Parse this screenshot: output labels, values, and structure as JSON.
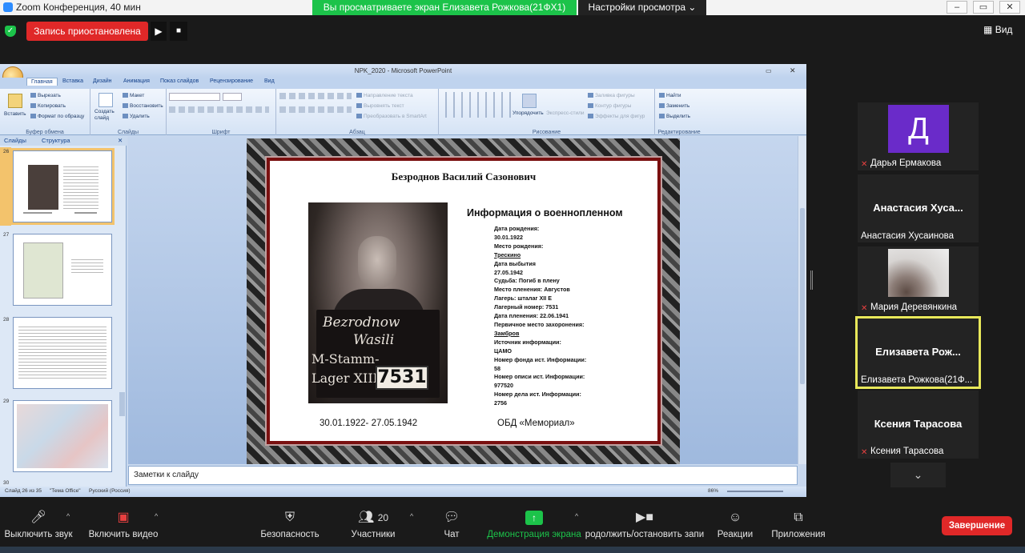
{
  "zoom": {
    "window_title": "Zoom Конференция, 40 мин",
    "share_banner": "Вы просматриваете экран Елизавета Рожкова(21ФХ1)",
    "view_settings": "Настройки просмотра",
    "recording_status": "Запись приостановлена",
    "view_label": "Вид"
  },
  "ppt": {
    "title": "NPK_2020 - Microsoft PowerPoint",
    "tabs": [
      "Главная",
      "Вставка",
      "Дизайн",
      "Анимация",
      "Показ слайдов",
      "Рецензирование",
      "Вид"
    ],
    "ribbon": {
      "paste": "Вставить",
      "cut": "Вырезать",
      "copy": "Копировать",
      "format_painter": "Формат по образцу",
      "clipboard_group": "Буфер обмена",
      "new_slide": "Создать слайд",
      "layout": "Макет",
      "reset": "Восстановить",
      "delete": "Удалить",
      "slides_group": "Слайды",
      "font_group": "Шрифт",
      "text_direction": "Направление текста",
      "align_text": "Выровнять текст",
      "smartart": "Преобразовать в SmartArt",
      "paragraph_group": "Абзац",
      "arrange": "Упорядочить",
      "quick_styles": "Экспресс-стили",
      "shape_fill": "Заливка фигуры",
      "shape_outline": "Контур фигуры",
      "shape_effects": "Эффекты для фигур",
      "drawing_group": "Рисование",
      "find": "Найти",
      "replace": "Заменить",
      "select": "Выделить",
      "editing_group": "Редактирование"
    },
    "pane_tabs": [
      "Слайды",
      "Структура"
    ],
    "thumb_numbers": [
      "26",
      "27",
      "28",
      "29",
      "30"
    ],
    "notes_placeholder": "Заметки к слайду",
    "status": {
      "slide": "Слайд 26 из 35",
      "theme": "\"Тема Office\"",
      "language": "Русский (Россия)",
      "zoom": "86%"
    }
  },
  "slide": {
    "name": "Безроднов Василий Сазонович",
    "photo_board": {
      "line1": "Bezrodnow",
      "line2": "Wasili",
      "line3": "M-Stamm-",
      "line4": "Lager XIIE",
      "number": "7531"
    },
    "info_heading": "Информация о военнопленном",
    "info_lines": [
      {
        "text": "Дата рождения:",
        "underline": false
      },
      {
        "text": "30.01.1922",
        "underline": false
      },
      {
        "text": "Место рождения:",
        "underline": false
      },
      {
        "text": "Трескино",
        "underline": true
      },
      {
        "text": "Дата выбытия",
        "underline": false
      },
      {
        "text": "27.05.1942",
        "underline": false
      },
      {
        "text": "Судьба:  Погиб в плену",
        "underline": false
      },
      {
        "text": "Место пленения:  Августов",
        "underline": false
      },
      {
        "text": "Лагерь:  шталаг XII E",
        "underline": false
      },
      {
        "text": "Лагерный номер:  7531",
        "underline": false
      },
      {
        "text": "Дата пленения:  22.06.1941",
        "underline": false
      },
      {
        "text": "Первичное место захоронения:",
        "underline": false
      },
      {
        "text": "Замбров",
        "underline": true
      },
      {
        "text": "Источник информации:",
        "underline": false
      },
      {
        "text": "ЦАМО",
        "underline": false
      },
      {
        "text": "Номер фонда ист. Информации:",
        "underline": false
      },
      {
        "text": "58",
        "underline": false
      },
      {
        "text": "Номер описи ист. Информации:",
        "underline": false
      },
      {
        "text": "977520",
        "underline": false
      },
      {
        "text": "Номер дела ист. Информации:",
        "underline": false
      },
      {
        "text": "2756",
        "underline": false
      }
    ],
    "dates": "30.01.1922- 27.05.1942",
    "source": "ОБД  «Мемориал»"
  },
  "participants": [
    {
      "avatar_letter": "Д",
      "center_name": "",
      "bottom_name": "Дарья Ермакова",
      "muted": true
    },
    {
      "avatar_letter": "",
      "center_name": "Анастасия  Хуса...",
      "bottom_name": "Анастасия Хусаинова",
      "muted": false
    },
    {
      "avatar_letter": "",
      "center_name": "",
      "bottom_name": "Мария Деревянкина",
      "muted": true
    },
    {
      "avatar_letter": "",
      "center_name": "Елизавета  Рож...",
      "bottom_name": "Елизавета Рожкова(21Ф...",
      "muted": false
    },
    {
      "avatar_letter": "",
      "center_name": "Ксения Тарасова",
      "bottom_name": "Ксения Тарасова",
      "muted": true
    }
  ],
  "toolbar": {
    "mute": "Выключить звук",
    "video": "Включить видео",
    "security": "Безопасность",
    "participants": "Участники",
    "participants_count": "20",
    "chat": "Чат",
    "share": "Демонстрация экрана",
    "record": "родолжить/остановить запи",
    "reactions": "Реакции",
    "apps": "Приложения",
    "end": "Завершение"
  },
  "colors": {
    "share_green": "#1cc34a",
    "record_red": "#e02828",
    "active_speaker": "#e8e85a",
    "slide_frame": "#7a1010"
  }
}
